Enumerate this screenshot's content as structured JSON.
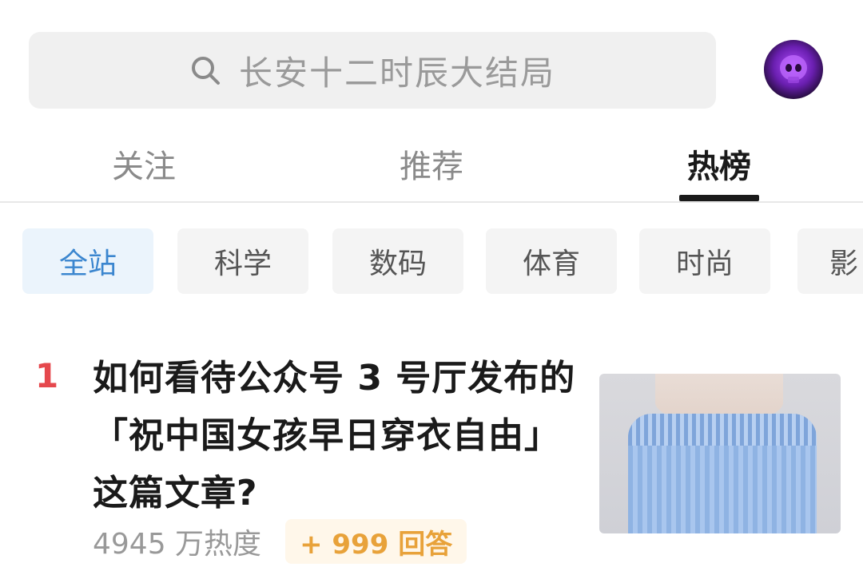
{
  "search": {
    "placeholder": "长安十二时辰大结局",
    "icon": "search-icon"
  },
  "tabs": [
    {
      "label": "关注",
      "active": false
    },
    {
      "label": "推荐",
      "active": false
    },
    {
      "label": "热榜",
      "active": true
    }
  ],
  "categories": [
    {
      "label": "全站",
      "active": true
    },
    {
      "label": "科学",
      "active": false
    },
    {
      "label": "数码",
      "active": false
    },
    {
      "label": "体育",
      "active": false
    },
    {
      "label": "时尚",
      "active": false
    },
    {
      "label": "影",
      "active": false
    }
  ],
  "hot_list": [
    {
      "rank": "1",
      "title": "如何看待公众号 3 号厅发布的「祝中国女孩早日穿衣自由」这篇文章?",
      "heat": "4945 万热度",
      "answers": "+ 999 回答",
      "thumbnail": "blue-off-shoulder-top-photo"
    }
  ],
  "colors": {
    "accent_blue": "#3b86cf",
    "rank_red": "#e5484d",
    "answer_orange": "#e8a23a",
    "text_dark": "#1a1a1a",
    "text_muted": "#999999"
  }
}
